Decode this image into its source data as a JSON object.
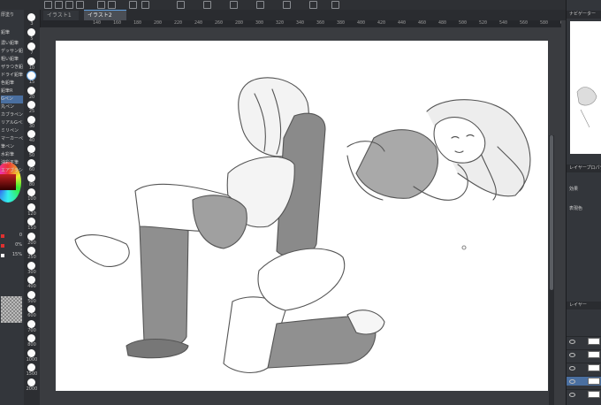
{
  "tabs": {
    "inactive_label": "イラスト1",
    "active_label": "イラスト2"
  },
  "ruler": {
    "ticks": [
      "140",
      "160",
      "180",
      "200",
      "220",
      "240",
      "260",
      "280",
      "300",
      "320",
      "340",
      "360",
      "380",
      "400",
      "420",
      "440",
      "460",
      "480",
      "500",
      "520",
      "540",
      "560",
      "580",
      "600"
    ]
  },
  "left_panel": {
    "header": "厚塗り",
    "subheader": "鉛筆",
    "items": [
      "濃い鉛筆",
      "デッサン鉛筆",
      "粗い鉛筆",
      "ザラつき鉛筆",
      "ドライ鉛筆",
      "色鉛筆",
      "鉛筆R",
      "Gペン",
      "丸ペン",
      "カブラペン",
      "リアルGペン",
      "ミリペン",
      "マーカーペン",
      "筆ペン",
      "水彩筆",
      "油彩平筆",
      "エアブラシ"
    ],
    "selected_index": 7
  },
  "brush_sizes": [
    "3",
    "5",
    "7",
    "10",
    "15",
    "20",
    "25",
    "30",
    "40",
    "50",
    "60",
    "80",
    "100",
    "120",
    "150",
    "200",
    "250",
    "300",
    "400",
    "500",
    "600",
    "700",
    "800",
    "1000",
    "1500",
    "2000"
  ],
  "selected_brush_size": "15",
  "color_values": [
    {
      "label": "R",
      "value": "0",
      "color": "#e03030"
    },
    {
      "label": "G",
      "value": "0%",
      "color": "#e03030"
    },
    {
      "label": "B",
      "value": "15%",
      "color": "#ffffff"
    }
  ],
  "right_panel": {
    "navigator_title": "ナビゲーター",
    "property_title": "レイヤープロパティ",
    "effect_label": "効果",
    "expression_label": "表現色",
    "layer_title": "レイヤー"
  },
  "colors": {
    "accent": "#5fa0e0",
    "canvas": "#ffffff",
    "bg": "#3a3c40"
  }
}
